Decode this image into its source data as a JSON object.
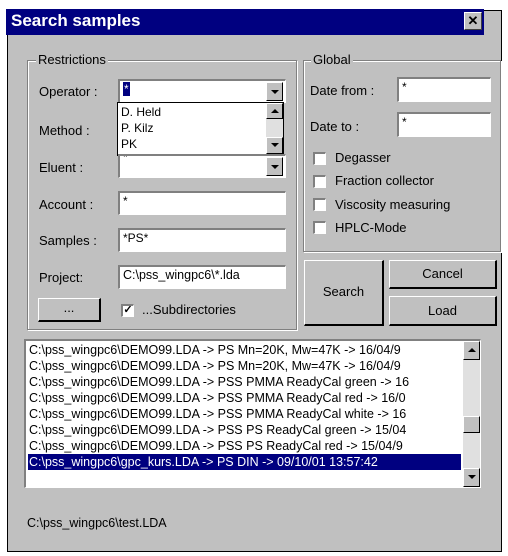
{
  "window": {
    "title": "Search samples",
    "close_label": "✕"
  },
  "restrictions": {
    "legend": "Restrictions",
    "operator": {
      "label": "Operator :",
      "value": "*"
    },
    "operator_options": [
      "D. Held",
      "P. Kilz",
      "PK"
    ],
    "method": {
      "label": "Method :"
    },
    "eluent": {
      "label": "Eluent :",
      "value": "*"
    },
    "account": {
      "label": "Account :",
      "value": "*"
    },
    "samples": {
      "label": "Samples :",
      "value": "*PS*"
    },
    "project": {
      "label": "Project:",
      "value": "C:\\pss_wingpc6\\*.lda"
    },
    "browse_label": "...",
    "subdirectories": {
      "label": "...Subdirectories",
      "checked": true
    }
  },
  "global": {
    "legend": "Global",
    "date_from": {
      "label": "Date from :",
      "value": "*"
    },
    "date_to": {
      "label": "Date to :",
      "value": "*"
    },
    "options": [
      {
        "label": "Degasser",
        "checked": false
      },
      {
        "label": "Fraction collector",
        "checked": false
      },
      {
        "label": "Viscosity measuring",
        "checked": false
      },
      {
        "label": "HPLC-Mode",
        "checked": false
      }
    ]
  },
  "buttons": {
    "search": "Search",
    "cancel": "Cancel",
    "load": "Load"
  },
  "results": [
    "C:\\pss_wingpc6\\DEMO99.LDA -> PS Mn=20K, Mw=47K -> 16/04/9",
    "C:\\pss_wingpc6\\DEMO99.LDA -> PS Mn=20K, Mw=47K -> 16/04/9",
    "C:\\pss_wingpc6\\DEMO99.LDA -> PSS PMMA ReadyCal green -> 16",
    "C:\\pss_wingpc6\\DEMO99.LDA -> PSS PMMA ReadyCal red -> 16/0",
    "C:\\pss_wingpc6\\DEMO99.LDA -> PSS PMMA ReadyCal white -> 16",
    "C:\\pss_wingpc6\\DEMO99.LDA -> PSS PS ReadyCal green -> 15/04",
    "C:\\pss_wingpc6\\DEMO99.LDA -> PSS PS ReadyCal red -> 15/04/9",
    "C:\\pss_wingpc6\\gpc_kurs.LDA -> PS DIN -> 09/10/01  13:57:42"
  ],
  "status_path": "C:\\pss_wingpc6\\test.LDA"
}
